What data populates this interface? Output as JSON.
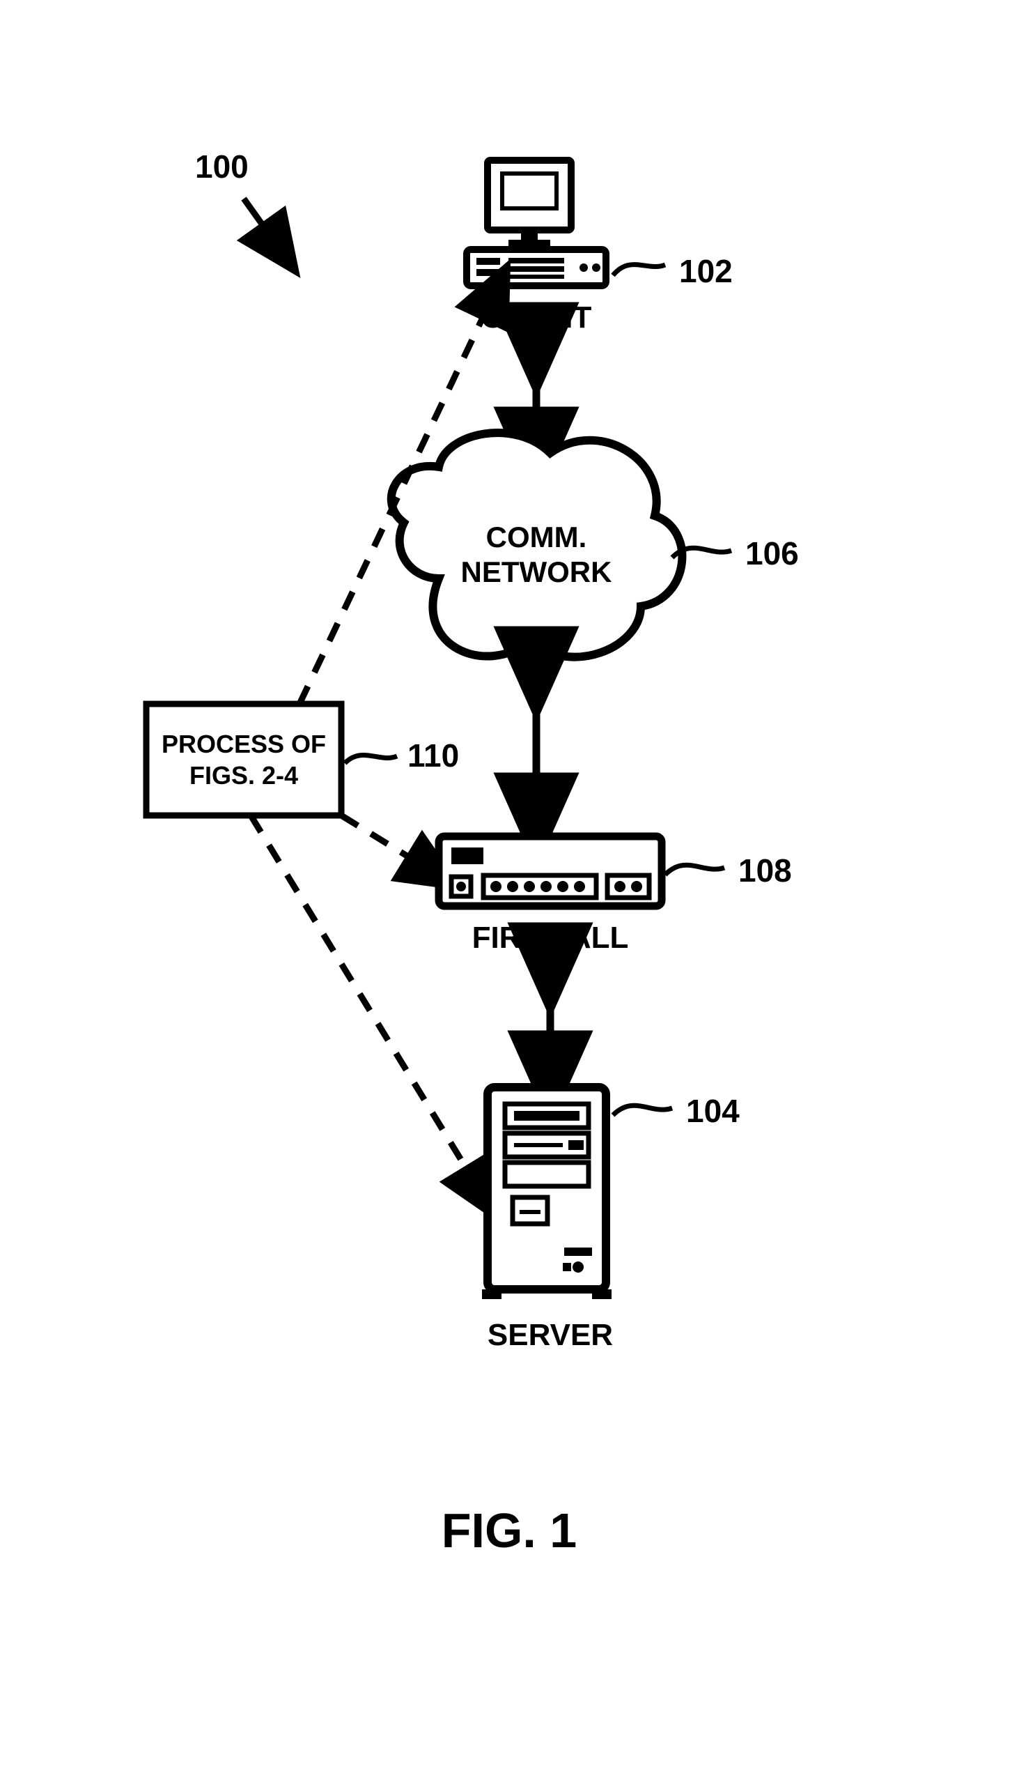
{
  "figure_ref": "100",
  "nodes": {
    "client": {
      "label": "CLIENT",
      "ref": "102"
    },
    "network": {
      "label_line1": "COMM.",
      "label_line2": "NETWORK",
      "ref": "106"
    },
    "process": {
      "label_line1": "PROCESS OF",
      "label_line2": "FIGS. 2-4",
      "ref": "110"
    },
    "firewall": {
      "label": "FIREWALL",
      "ref": "108"
    },
    "server": {
      "label": "SERVER",
      "ref": "104"
    }
  },
  "caption": "FIG. 1"
}
